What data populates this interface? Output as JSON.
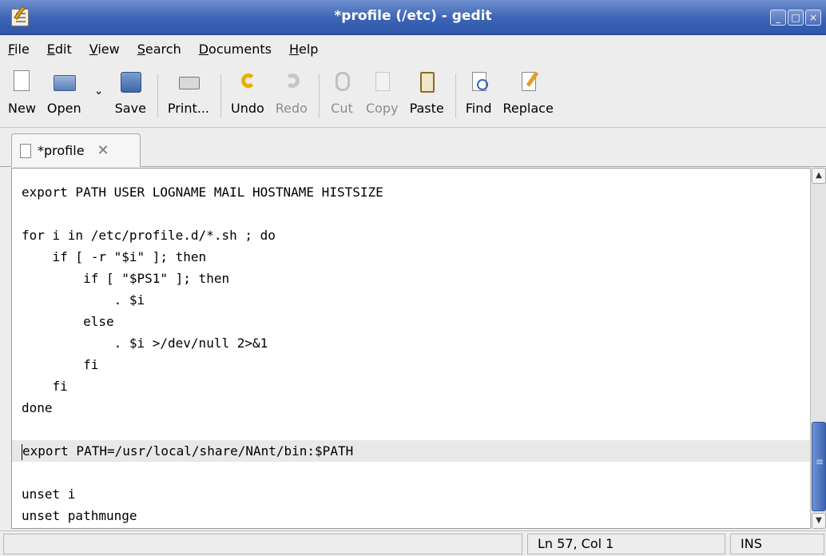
{
  "window": {
    "title": "*profile (/etc) - gedit",
    "controls": [
      "_",
      "□",
      "×"
    ]
  },
  "menu": [
    "File",
    "Edit",
    "View",
    "Search",
    "Documents",
    "Help"
  ],
  "toolbar": {
    "new": "New",
    "open": "Open",
    "save": "Save",
    "print": "Print...",
    "undo": "Undo",
    "redo": "Redo",
    "cut": "Cut",
    "copy": "Copy",
    "paste": "Paste",
    "find": "Find",
    "replace": "Replace",
    "open_dropdown_glyph": "⌄"
  },
  "tab": {
    "label": "*profile",
    "close_glyph": "✕"
  },
  "editor": {
    "lines": [
      "export PATH USER LOGNAME MAIL HOSTNAME HISTSIZE",
      "",
      "for i in /etc/profile.d/*.sh ; do",
      "    if [ -r \"$i\" ]; then",
      "        if [ \"$PS1\" ]; then",
      "            . $i",
      "        else",
      "            . $i >/dev/null 2>&1",
      "        fi",
      "    fi",
      "done",
      "",
      "export PATH=/usr/local/share/NAnt/bin:$PATH",
      "",
      "unset i",
      "unset pathmunge"
    ],
    "current_line_index": 12
  },
  "status": {
    "message": "",
    "position": "Ln 57, Col 1",
    "mode": "INS"
  },
  "colors": {
    "titlebar": "#3b63b6",
    "current_line": "#e8e8e8",
    "scroll_thumb": "#3d66b4"
  }
}
